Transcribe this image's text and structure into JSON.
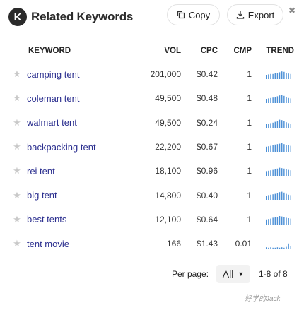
{
  "header": {
    "logo_letter": "K",
    "title": "Related Keywords",
    "copy_label": "Copy",
    "export_label": "Export",
    "close_glyph": "✖"
  },
  "table": {
    "columns": [
      "KEYWORD",
      "VOL",
      "CPC",
      "CMP",
      "TREND"
    ],
    "rows": [
      {
        "keyword": "camping tent",
        "vol": "201,000",
        "cpc": "$0.42",
        "cmp": "1",
        "trend": [
          0.5,
          0.55,
          0.6,
          0.6,
          0.7,
          0.75,
          0.8,
          0.9,
          0.85,
          0.75,
          0.65,
          0.6
        ]
      },
      {
        "keyword": "coleman tent",
        "vol": "49,500",
        "cpc": "$0.48",
        "cmp": "1",
        "trend": [
          0.5,
          0.55,
          0.6,
          0.65,
          0.75,
          0.8,
          0.9,
          0.95,
          0.85,
          0.7,
          0.6,
          0.55
        ]
      },
      {
        "keyword": "walmart tent",
        "vol": "49,500",
        "cpc": "$0.24",
        "cmp": "1",
        "trend": [
          0.45,
          0.5,
          0.55,
          0.6,
          0.7,
          0.8,
          0.95,
          0.9,
          0.8,
          0.65,
          0.55,
          0.5
        ]
      },
      {
        "keyword": "backpacking tent",
        "vol": "22,200",
        "cpc": "$0.67",
        "cmp": "1",
        "trend": [
          0.6,
          0.65,
          0.7,
          0.75,
          0.85,
          0.9,
          0.95,
          1.0,
          0.9,
          0.8,
          0.75,
          0.7
        ]
      },
      {
        "keyword": "rei tent",
        "vol": "18,100",
        "cpc": "$0.96",
        "cmp": "1",
        "trend": [
          0.55,
          0.6,
          0.65,
          0.7,
          0.8,
          0.85,
          0.95,
          0.9,
          0.85,
          0.75,
          0.7,
          0.65
        ]
      },
      {
        "keyword": "big tent",
        "vol": "14,800",
        "cpc": "$0.40",
        "cmp": "1",
        "trend": [
          0.5,
          0.55,
          0.6,
          0.65,
          0.7,
          0.8,
          0.9,
          0.95,
          0.85,
          0.7,
          0.6,
          0.55
        ]
      },
      {
        "keyword": "best tents",
        "vol": "12,100",
        "cpc": "$0.64",
        "cmp": "1",
        "trend": [
          0.6,
          0.65,
          0.7,
          0.8,
          0.85,
          0.9,
          1.0,
          0.95,
          0.9,
          0.8,
          0.75,
          0.7
        ]
      },
      {
        "keyword": "tent movie",
        "vol": "166",
        "cpc": "$1.43",
        "cmp": "0.01",
        "trend": [
          0.15,
          0.1,
          0.15,
          0.1,
          0.1,
          0.15,
          0.1,
          0.15,
          0.1,
          0.2,
          0.6,
          0.3
        ]
      }
    ]
  },
  "footer": {
    "per_page_label": "Per page:",
    "per_page_value": "All",
    "range_text": "1-8 of 8"
  },
  "watermark": "好学的Jack",
  "colors": {
    "keyword_link": "#2b2f8f",
    "trend_bar": "#4a8fd6",
    "star": "#c9c9c9"
  }
}
